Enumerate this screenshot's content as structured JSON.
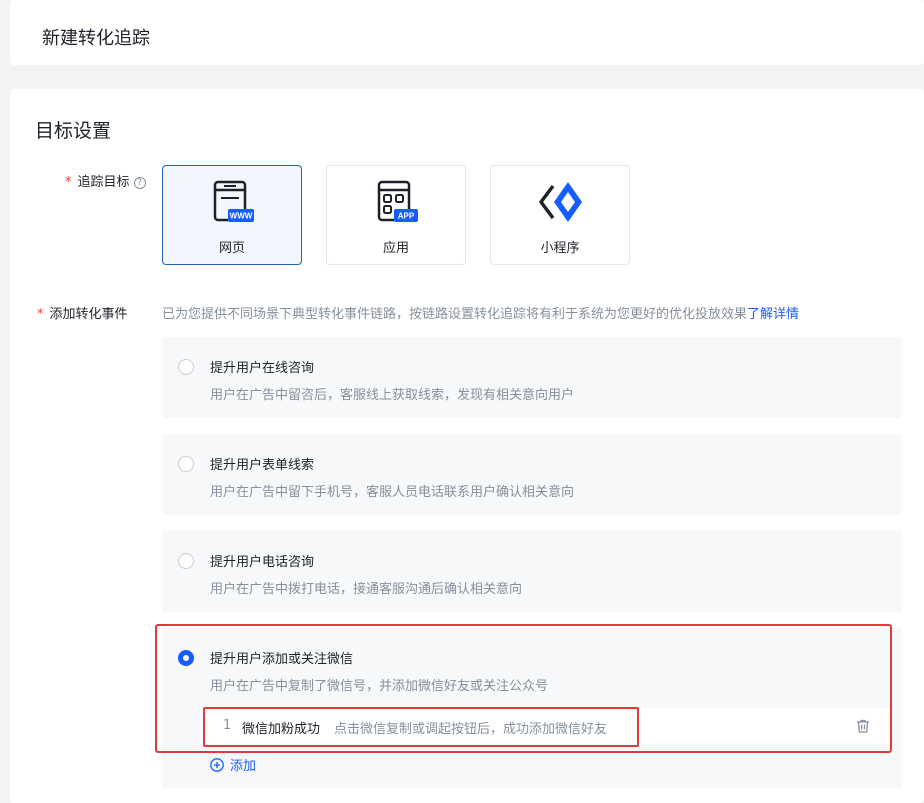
{
  "header": {
    "title": "新建转化追踪"
  },
  "section": {
    "title": "目标设置"
  },
  "tracking_target": {
    "required_mark": "*",
    "label": "追踪目标",
    "help_icon": "question-circle-icon",
    "options": [
      {
        "label": "网页",
        "icon": "webpage-www-icon",
        "badge": "WWW",
        "selected": true
      },
      {
        "label": "应用",
        "icon": "app-icon",
        "badge": "APP",
        "selected": false
      },
      {
        "label": "小程序",
        "icon": "mini-program-icon",
        "selected": false
      }
    ]
  },
  "conversion_events": {
    "required_mark": "*",
    "label": "添加转化事件",
    "description": "已为您提供不同场景下典型转化事件链路，按链路设置转化追踪将有利于系统为您更好的优化投放效果",
    "learn_more": "了解详情",
    "options": [
      {
        "title": "提升用户在线咨询",
        "desc": "用户在广告中留咨后，客服线上获取线索，发现有相关意向用户",
        "checked": false
      },
      {
        "title": "提升用户表单线索",
        "desc": "用户在广告中留下手机号，客服人员电话联系用户确认相关意向",
        "checked": false
      },
      {
        "title": "提升用户电话咨询",
        "desc": "用户在广告中拨打电话，接通客服沟通后确认相关意向",
        "checked": false
      },
      {
        "title": "提升用户添加或关注微信",
        "desc": "用户在广告中复制了微信号，并添加微信好友或关注公众号",
        "checked": true
      }
    ],
    "sub_event": {
      "index": "1",
      "name": "微信加粉成功",
      "desc": "点击微信复制或调起按钮后，成功添加微信好友"
    },
    "add_label": "添加"
  },
  "colors": {
    "primary": "#165dff",
    "selected_border": "#1f64b8",
    "highlight": "#e03a3a",
    "required": "#f53f3f"
  }
}
